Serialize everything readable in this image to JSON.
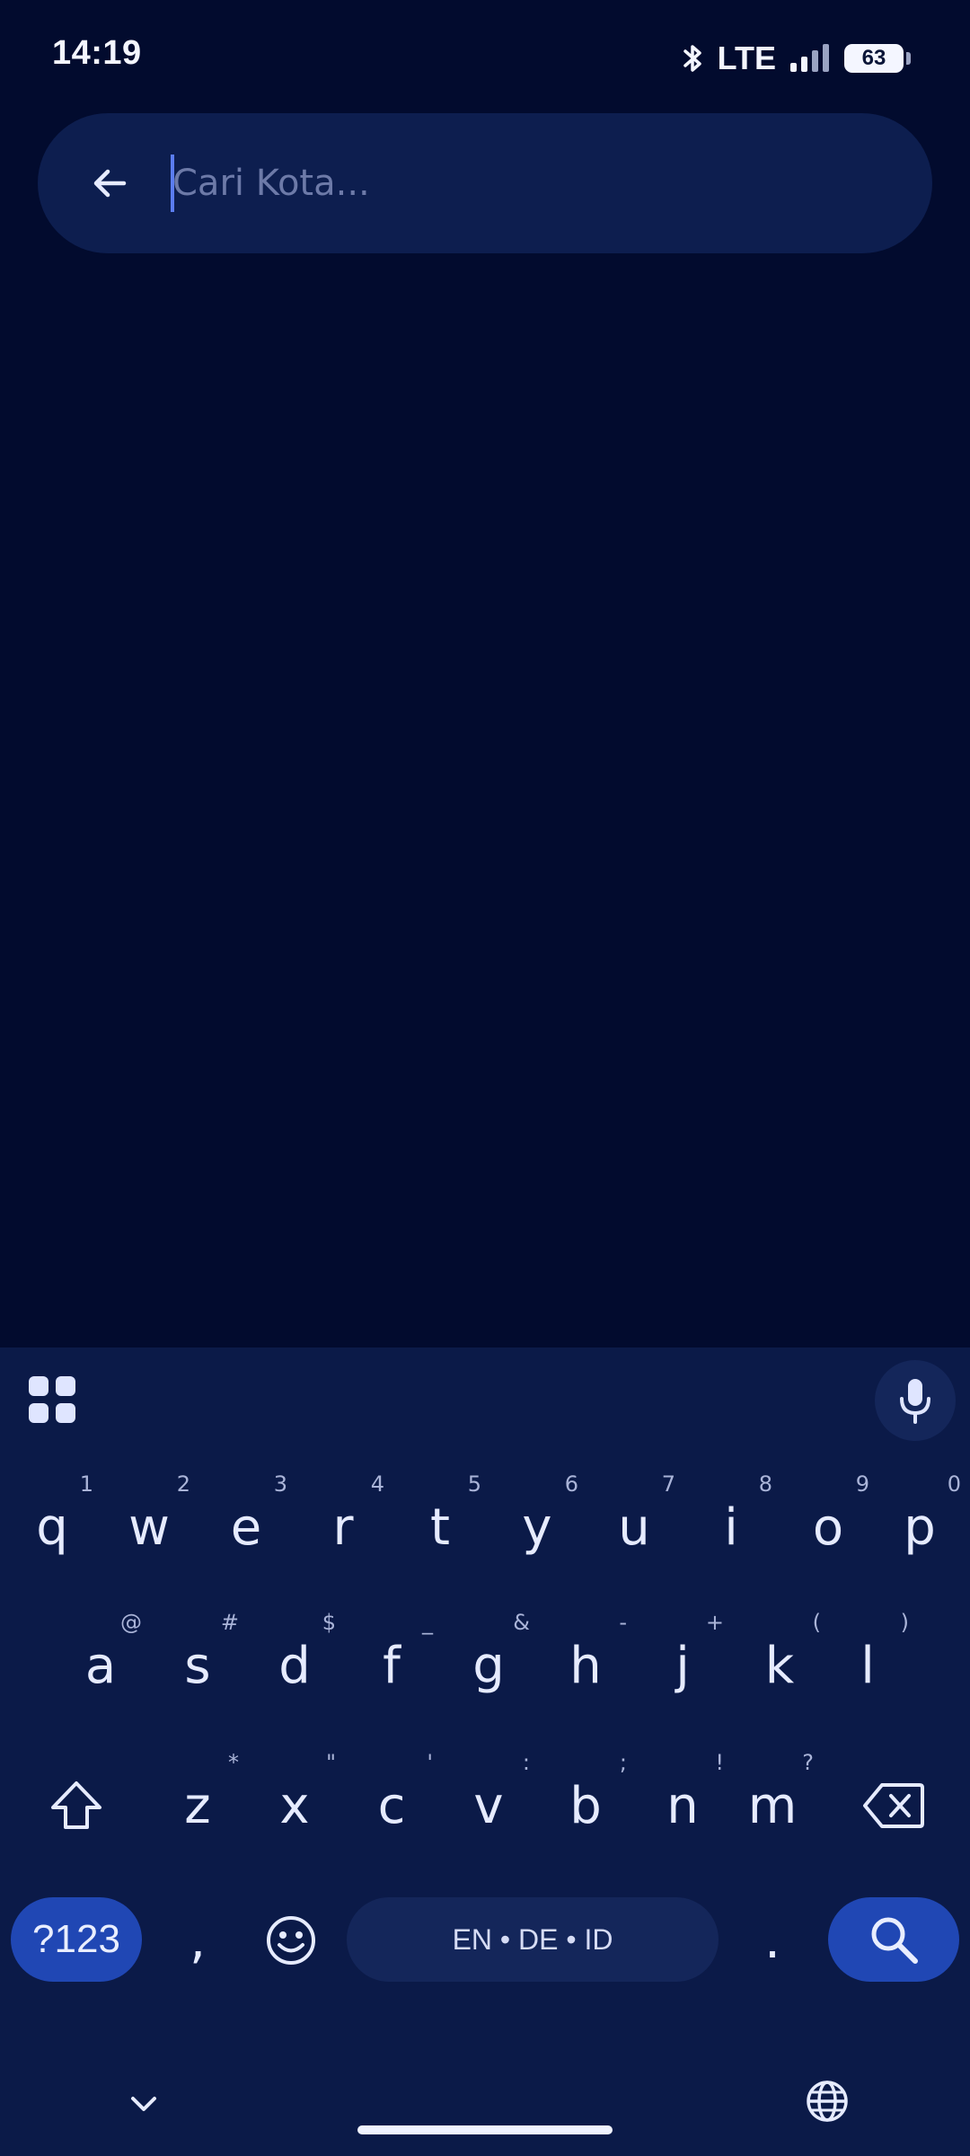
{
  "status_bar": {
    "time": "14:19",
    "network": "LTE",
    "battery": "63"
  },
  "search": {
    "placeholder": "Cari Kota..."
  },
  "keyboard": {
    "row1": [
      {
        "key": "q",
        "hint": "1"
      },
      {
        "key": "w",
        "hint": "2"
      },
      {
        "key": "e",
        "hint": "3"
      },
      {
        "key": "r",
        "hint": "4"
      },
      {
        "key": "t",
        "hint": "5"
      },
      {
        "key": "y",
        "hint": "6"
      },
      {
        "key": "u",
        "hint": "7"
      },
      {
        "key": "i",
        "hint": "8"
      },
      {
        "key": "o",
        "hint": "9"
      },
      {
        "key": "p",
        "hint": "0"
      }
    ],
    "row2": [
      {
        "key": "a",
        "hint": "@"
      },
      {
        "key": "s",
        "hint": "#"
      },
      {
        "key": "d",
        "hint": "$"
      },
      {
        "key": "f",
        "hint": "_"
      },
      {
        "key": "g",
        "hint": "&"
      },
      {
        "key": "h",
        "hint": "-"
      },
      {
        "key": "j",
        "hint": "+"
      },
      {
        "key": "k",
        "hint": "("
      },
      {
        "key": "l",
        "hint": ")"
      }
    ],
    "row3": [
      {
        "key": "z",
        "hint": "*"
      },
      {
        "key": "x",
        "hint": "\""
      },
      {
        "key": "c",
        "hint": "'"
      },
      {
        "key": "v",
        "hint": ":"
      },
      {
        "key": "b",
        "hint": ";"
      },
      {
        "key": "n",
        "hint": "!"
      },
      {
        "key": "m",
        "hint": "?"
      }
    ],
    "symbols_label": "?123",
    "comma": ",",
    "period": ".",
    "space_label": "EN • DE • ID"
  }
}
